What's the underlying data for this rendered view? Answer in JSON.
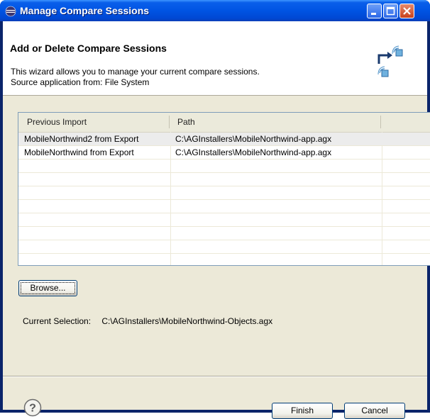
{
  "window": {
    "title": "Manage Compare Sessions",
    "controls": [
      "minimize",
      "maximize",
      "close"
    ]
  },
  "header": {
    "title": "Add or Delete Compare Sessions",
    "description_line1": "This wizard allows you to manage your current compare sessions.",
    "description_line2": "Source application from: File System",
    "banner_icon": "compare-sessions-banner-icon"
  },
  "table": {
    "columns": [
      "Previous Import",
      "Path"
    ],
    "rows": [
      {
        "previous_import": "MobileNorthwind2 from Export",
        "path": "C:\\AGInstallers\\MobileNorthwind-app.agx",
        "selected": true
      },
      {
        "previous_import": "MobileNorthwind from Export",
        "path": "C:\\AGInstallers\\MobileNorthwind-app.agx",
        "selected": false
      }
    ]
  },
  "browse_button": {
    "label": "Browse...",
    "mnemonic": "B"
  },
  "current_selection": {
    "label": "Current Selection:",
    "value": "C:\\AGInstallers\\MobileNorthwind-Objects.agx"
  },
  "footer": {
    "help_icon": "help-icon",
    "finish_label": "Finish",
    "finish_mnemonic": "F",
    "cancel_label": "Cancel"
  },
  "colors": {
    "titlebar": "#0054e3",
    "dialog_bg": "#ece9d8",
    "header_bg": "#ffffff",
    "selected_row": "#ececec"
  }
}
